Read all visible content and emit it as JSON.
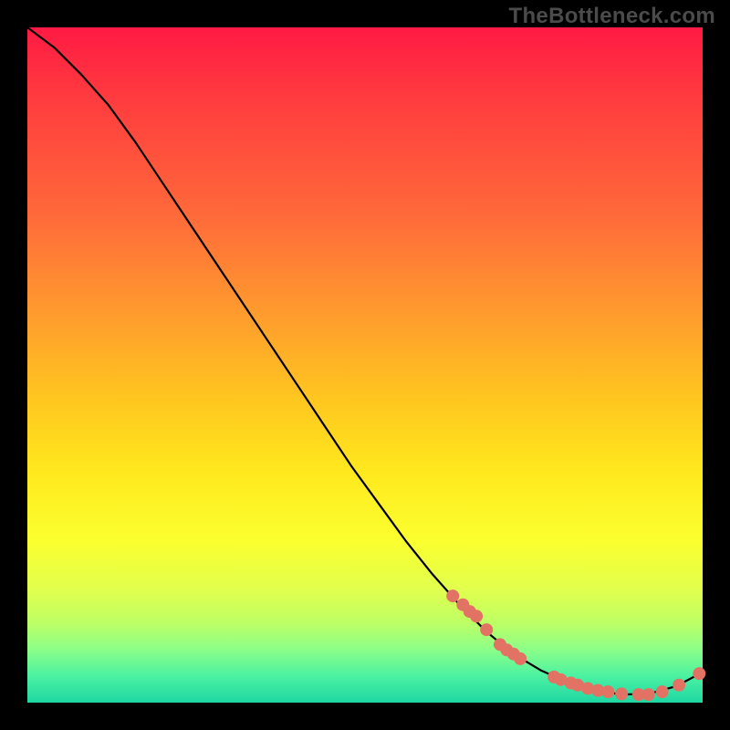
{
  "watermark": "TheBottleneck.com",
  "colors": {
    "background": "#000000",
    "curve": "#000000",
    "dot": "#e17264",
    "gradient_top": "#ff1a44",
    "gradient_bottom": "#1fd7a3"
  },
  "chart_data": {
    "type": "line",
    "title": "",
    "xlabel": "",
    "ylabel": "",
    "xlim": [
      0,
      100
    ],
    "ylim": [
      0,
      100
    ],
    "note": "No axis ticks or numeric labels are visible; values below are normalized 0–100 estimates read from pixel positions. y is inverted relative to screen (0 = bottom, 100 = top).",
    "series": [
      {
        "name": "bottleneck-curve",
        "x": [
          0,
          4,
          8,
          12,
          16,
          20,
          24,
          28,
          32,
          36,
          40,
          44,
          48,
          52,
          56,
          60,
          64,
          68,
          72,
          76,
          80,
          84,
          88,
          92,
          96,
          100
        ],
        "y": [
          100,
          97,
          93,
          88.5,
          83,
          77,
          71,
          65,
          59,
          53,
          47,
          41,
          35,
          29.5,
          24,
          19,
          14.5,
          10.5,
          7.2,
          4.8,
          3.0,
          1.8,
          1.2,
          1.3,
          2.4,
          4.5
        ]
      }
    ],
    "scatter_points": {
      "name": "highlighted-dots",
      "x": [
        63,
        64.5,
        65.5,
        66.5,
        68,
        70,
        71,
        72,
        73,
        78,
        79,
        80.5,
        81.5,
        83,
        84.5,
        86,
        88,
        90.5,
        92,
        94,
        96.5,
        99.5
      ],
      "y": [
        15.8,
        14.5,
        13.5,
        12.8,
        10.8,
        8.6,
        7.8,
        7.2,
        6.5,
        3.8,
        3.4,
        2.9,
        2.6,
        2.1,
        1.8,
        1.6,
        1.3,
        1.2,
        1.2,
        1.6,
        2.6,
        4.3
      ]
    }
  }
}
